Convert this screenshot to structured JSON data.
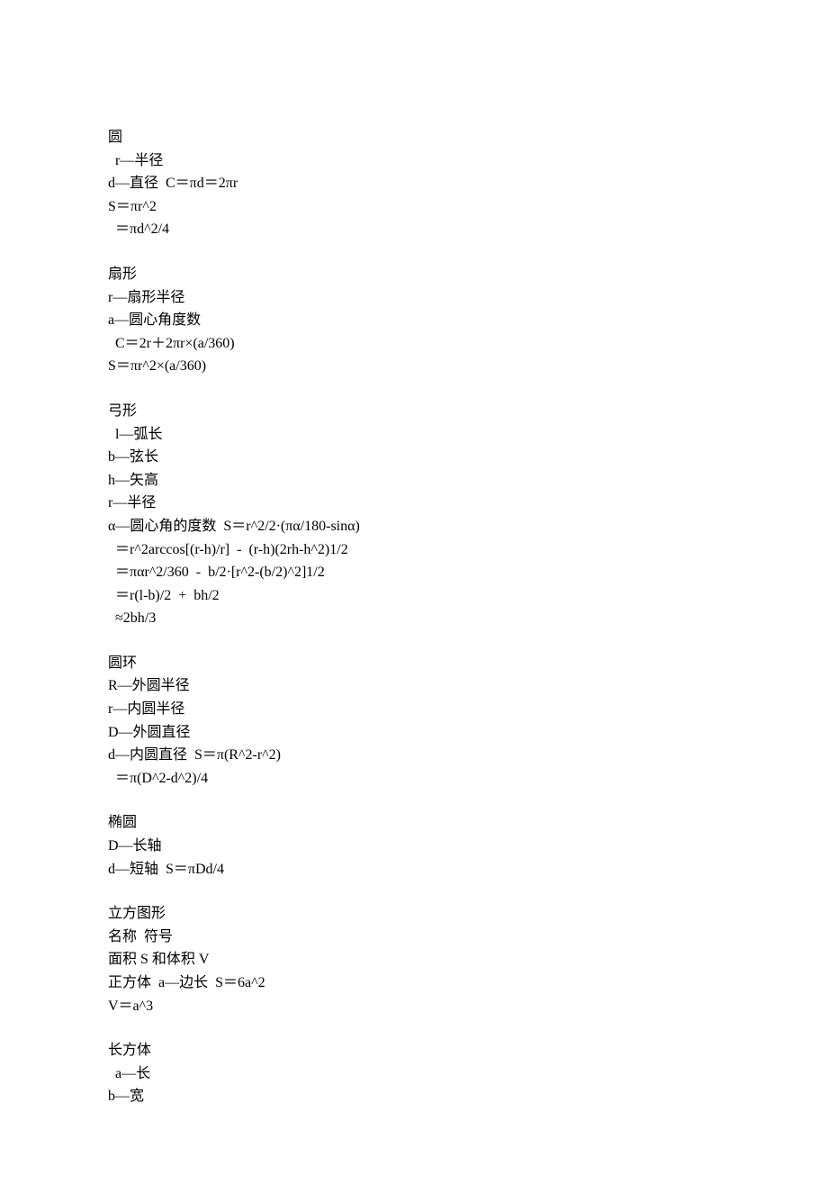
{
  "sections": [
    {
      "name": "circle",
      "lines": [
        "圆",
        "  r—半径",
        "d—直径  C＝πd＝2πr",
        "S＝πr^2",
        "  ＝πd^2/4"
      ]
    },
    {
      "name": "sector",
      "lines": [
        "扇形",
        "r—扇形半径",
        "a—圆心角度数",
        "  C＝2r＋2πr×(a/360)",
        "S＝πr^2×(a/360)"
      ]
    },
    {
      "name": "segment",
      "lines": [
        "弓形",
        "  l—弧长",
        "b—弦长",
        "h—矢高",
        "r—半径",
        "α—圆心角的度数  S＝r^2/2·(πα/180-sinα)",
        "  ＝r^2arccos[(r-h)/r]  -  (r-h)(2rh-h^2)1/2",
        "  ＝παr^2/360  -  b/2·[r^2-(b/2)^2]1/2",
        "  ＝r(l-b)/2  +  bh/2",
        "  ≈2bh/3"
      ]
    },
    {
      "name": "annulus",
      "lines": [
        "圆环",
        "R—外圆半径",
        "r—内圆半径",
        "D—外圆直径",
        "d—内圆直径  S＝π(R^2-r^2)",
        "  ＝π(D^2-d^2)/4"
      ]
    },
    {
      "name": "ellipse",
      "lines": [
        "椭圆",
        "D—长轴",
        "d—短轴  S＝πDd/4"
      ]
    },
    {
      "name": "solids-header",
      "lines": [
        "立方图形",
        "名称  符号",
        "面积 S 和体积 V",
        "正方体  a—边长  S＝6a^2",
        "V＝a^3"
      ]
    },
    {
      "name": "cuboid",
      "lines": [
        "长方体",
        "  a—长",
        "b—宽"
      ]
    }
  ]
}
